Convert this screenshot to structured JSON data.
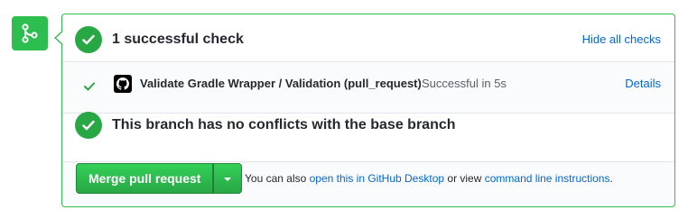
{
  "checks": {
    "heading": "1 successful check",
    "hide_all_label": "Hide all checks",
    "items": [
      {
        "name": "Validate Gradle Wrapper / Validation (pull_request)",
        "status": "Successful in 5s",
        "details_label": "Details"
      }
    ]
  },
  "conflicts": {
    "heading": "This branch has no conflicts with the base branch"
  },
  "merge": {
    "button_label": "Merge pull request",
    "text_prefix": "You can also",
    "desktop_link": "open this in GitHub Desktop",
    "text_middle": "or view",
    "cli_link": "command line instructions",
    "text_suffix": "."
  },
  "colors": {
    "success": "#28a745",
    "brand_green": "#2cbe4e",
    "link": "#0366d6"
  },
  "icons": {
    "merge": "git-merge-icon",
    "check": "check-icon",
    "github": "github-mark-icon",
    "caret": "caret-down-icon"
  }
}
